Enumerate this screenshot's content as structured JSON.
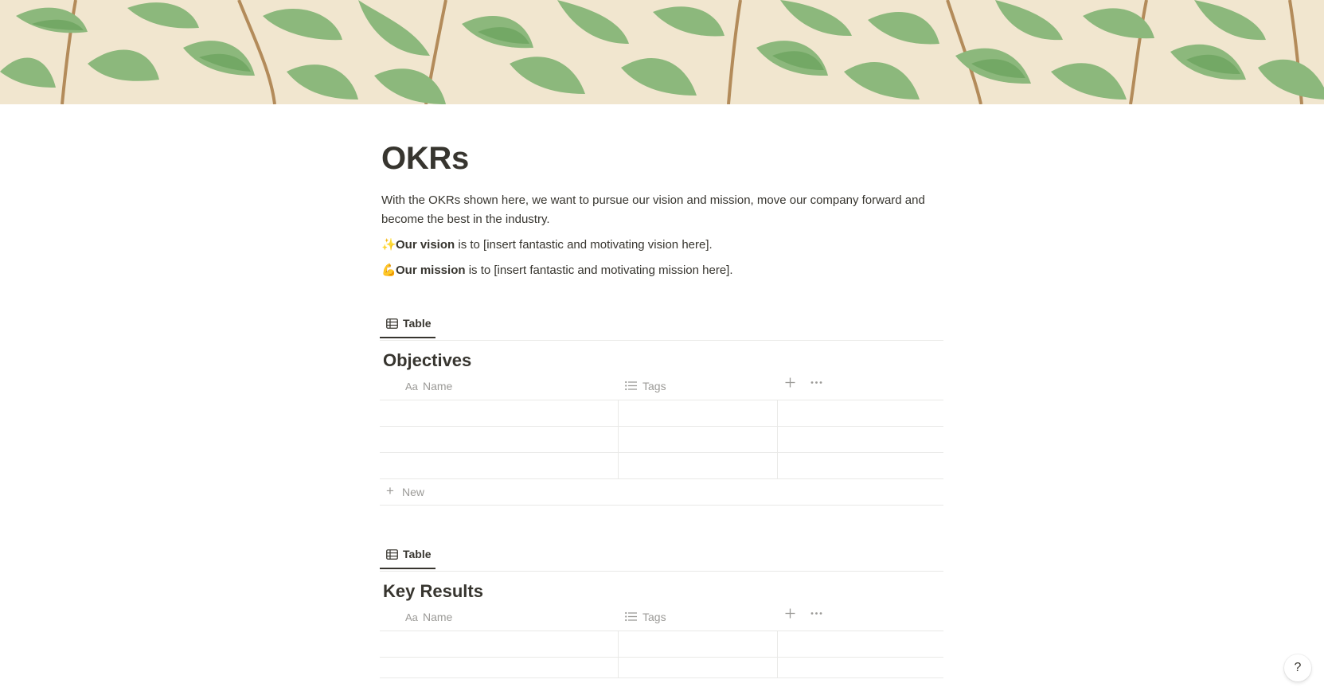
{
  "page": {
    "title": "OKRs",
    "intro": "With the OKRs shown here, we want to pursue our vision and mission, move our company forward and become the best in the industry.",
    "vision": {
      "emoji": "✨",
      "bold": "Our vision",
      "rest": " is to [insert fantastic and motivating vision here]."
    },
    "mission": {
      "emoji": "💪",
      "bold": "Our mission",
      "rest": " is to [insert fantastic and motivating mission here]."
    }
  },
  "objectives": {
    "view_tab": "Table",
    "title": "Objectives",
    "columns": {
      "name": "Name",
      "name_icon": "Aa",
      "tags": "Tags"
    },
    "new_label": "New"
  },
  "key_results": {
    "view_tab": "Table",
    "title": "Key Results",
    "columns": {
      "name": "Name",
      "name_icon": "Aa",
      "tags": "Tags"
    }
  },
  "help_label": "?",
  "colors": {
    "text": "#37352f",
    "muted": "#9b9a97",
    "border": "#e9e9e7",
    "cover_bg": "#f1e6cf",
    "leaf": "#8cb87c"
  }
}
